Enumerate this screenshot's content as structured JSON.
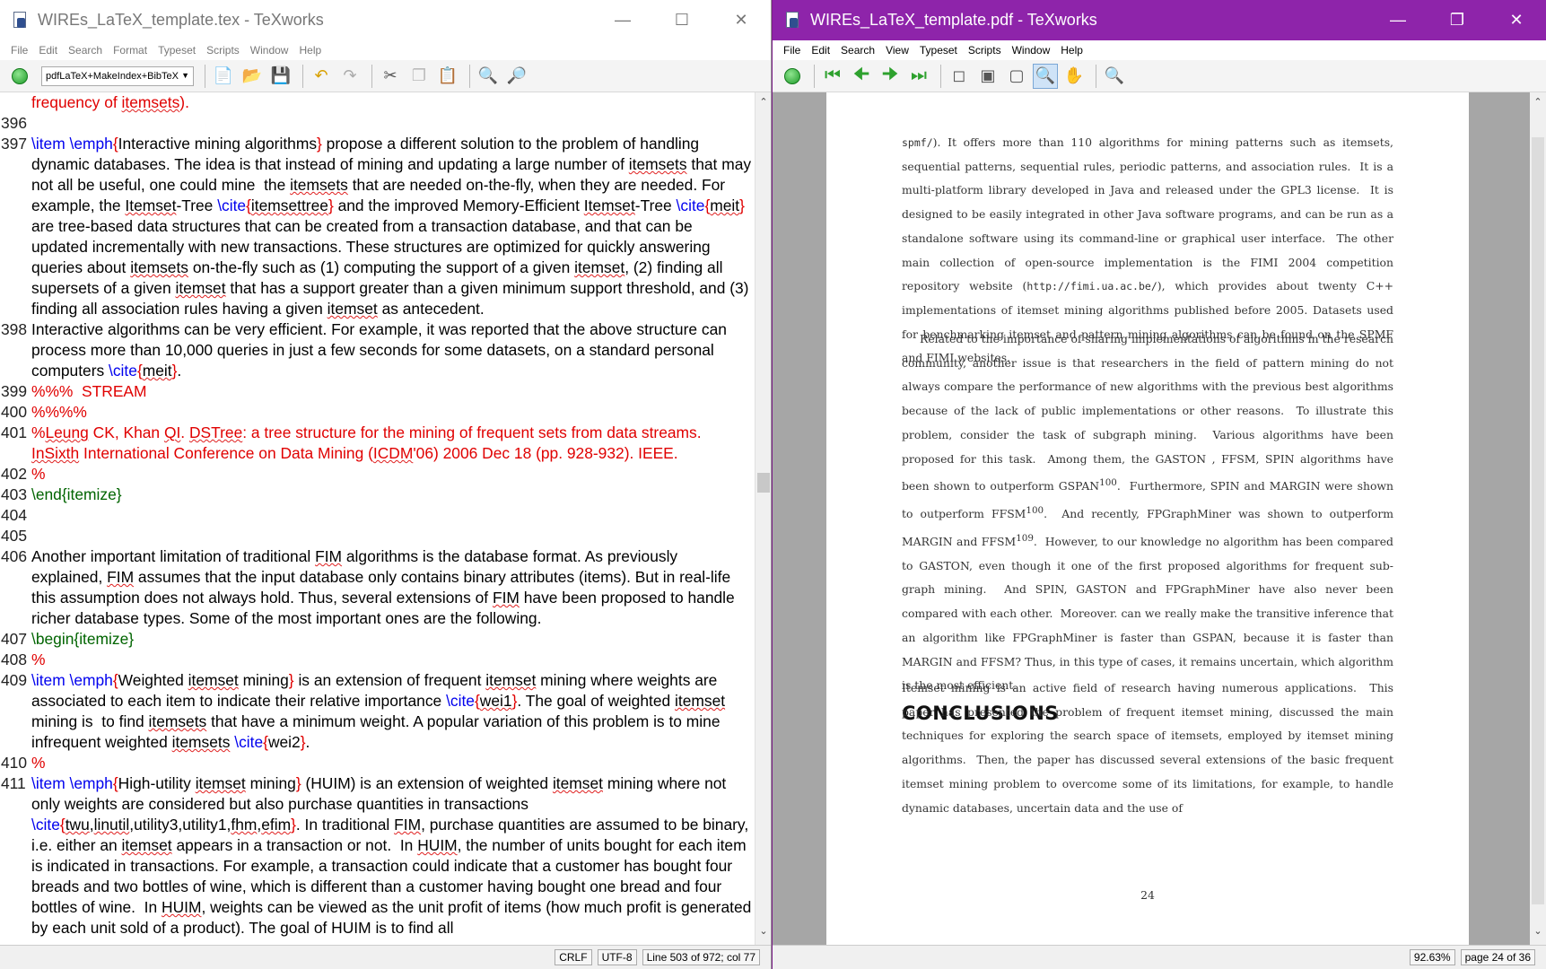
{
  "editor_window": {
    "title": "WIREs_LaTeX_template.tex - TeXworks",
    "menu": [
      "File",
      "Edit",
      "Search",
      "Format",
      "Typeset",
      "Scripts",
      "Window",
      "Help"
    ],
    "typeset_engine": "pdfLaTeX+MakeIndex+BibTeX",
    "status": {
      "line_ending": "CRLF",
      "encoding": "UTF-8",
      "position": "Line 503 of 972; col 77"
    },
    "lines": [
      {
        "n": "",
        "html": "<span class='red'>frequency of <span class='sq'>itemsets</span>).</span>"
      },
      {
        "n": "396",
        "html": ""
      },
      {
        "n": "397",
        "html": "<span class='blue'>\\item \\emph</span><span class='red'>{</span>Interactive mining algorithms<span class='red'>}</span> propose a different solution to the problem of handling dynamic databases. The idea is that instead of mining and updating a large number of <span class='sq'>itemsets</span> that may not all be useful, one could mine &nbsp;the <span class='sq'>itemsets</span> that are needed on-the-fly, when they are needed. For example, the <span class='sq'>Itemset</span>-Tree <span class='blue'>\\cite</span><span class='red'>{</span><span class='sq'>itemsettree</span><span class='red'>}</span> and the improved Memory-Efficient <span class='sq'>Itemset</span>-Tree <span class='blue'>\\cite</span><span class='red'>{</span><span class='sq'>meit</span><span class='red'>}</span> are tree-based data structures that can be created from a transaction database, and that can be updated incrementally with new transactions. These structures are optimized for quickly answering queries about <span class='sq'>itemsets</span> on-the-fly such as (1) computing the support of a given <span class='sq'>itemset</span>, (2) finding all supersets of a given <span class='sq'>itemset</span> that has a support greater than a given minimum support threshold, and (3) finding all association rules having a given <span class='sq'>itemset</span> as antecedent."
      },
      {
        "n": "398",
        "html": "Interactive algorithms can be very efficient. For example, it was reported that the above structure can process more than 10,000 queries in just a few seconds for some datasets, on a standard personal computers <span class='blue'>\\cite</span><span class='red'>{</span><span class='sq'>meit</span><span class='red'>}</span>."
      },
      {
        "n": "399",
        "html": "<span class='red'>%%% &nbsp;STREAM</span>"
      },
      {
        "n": "400",
        "html": "<span class='red'>%%%%</span>"
      },
      {
        "n": "401",
        "html": "<span class='red'>%<span class='sq'>Leung</span> CK, Khan <span class='sq'>QI</span>. <span class='sq'>DSTree</span>: a tree structure for the mining of frequent sets from data streams. <span class='sq'>InSixth</span> International Conference on Data Mining (<span class='sq'>ICDM</span>'06) 2006 Dec 18 (pp. 928-932). IEEE.</span>"
      },
      {
        "n": "402",
        "html": "<span class='red'>%</span>"
      },
      {
        "n": "403",
        "html": "<span class='green'>\\end{itemize}</span>"
      },
      {
        "n": "404",
        "html": ""
      },
      {
        "n": "405",
        "html": ""
      },
      {
        "n": "406",
        "html": "Another important limitation of traditional <span class='sq'>FIM</span> algorithms is the database format. As previously explained, <span class='sq'>FIM</span> assumes that the input database only contains binary attributes (items). But in real-life this assumption does not always hold. Thus, several extensions of <span class='sq'>FIM</span> have been proposed to handle richer database types. Some of the most important ones are the following."
      },
      {
        "n": "407",
        "html": "<span class='green'>\\begin{itemize}</span>"
      },
      {
        "n": "408",
        "html": "<span class='red'>%</span>"
      },
      {
        "n": "409",
        "html": "<span class='blue'>\\item \\emph</span><span class='red'>{</span>Weighted <span class='sq'>itemset</span> mining<span class='red'>}</span> is an extension of frequent <span class='sq'>itemset</span> mining where weights are associated to each item to indicate their relative importance <span class='blue'>\\cite</span><span class='red'>{</span><span class='sq'>wei1</span><span class='red'>}</span>. The goal of weighted <span class='sq'>itemset</span> mining is &nbsp;to find <span class='sq'>itemsets</span> that have a minimum weight. A popular variation of this problem is to mine infrequent weighted <span class='sq'>itemsets</span> <span class='blue'>\\cite</span><span class='red'>{</span>wei2<span class='red'>}</span>."
      },
      {
        "n": "410",
        "html": "<span class='red'>%</span>"
      },
      {
        "n": "411",
        "html": "<span class='blue'>\\item \\emph</span><span class='red'>{</span>High-utility <span class='sq'>itemset</span> mining<span class='red'>}</span> (HUIM) is an extension of weighted <span class='sq'>itemset</span> mining where not only weights are considered but also purchase quantities in transactions <span class='blue'>\\cite</span><span class='red'>{</span><span class='sq'>twu</span>,<span class='sq'>linutil</span>,utility3,utility1,<span class='sq'>fhm</span>,<span class='sq'>efim</span><span class='red'>}</span>. In traditional <span class='sq'>FIM</span>, purchase quantities are assumed to be binary, i.e. either an <span class='sq'>itemset</span> appears in a transaction or not. &nbsp;In <span class='sq'>HUIM</span>, the number of units bought for each item is indicated in transactions. For example, a transaction could indicate that a customer has bought four breads and two bottles of wine, which is different than a customer having bought one bread and four bottles of wine. &nbsp;In <span class='sq'>HUIM</span>, weights can be viewed as the unit profit of items (how much profit is generated by each unit sold of a product). The goal of HUIM is to find all"
      }
    ]
  },
  "viewer_window": {
    "title": "WIREs_LaTeX_template.pdf - TeXworks",
    "menu": [
      "File",
      "Edit",
      "Search",
      "View",
      "Typeset",
      "Scripts",
      "Window",
      "Help"
    ],
    "status": {
      "zoom": "92.63%",
      "page": "page 24 of 36"
    },
    "paragraph1": "<span class='mono'>spmf/</span>). It offers more than 110 algorithms for mining patterns such as itemsets, sequential patterns, sequential rules, periodic patterns, and association rules. &nbsp;It is a multi-platform library developed in Java and released under the GPL3 license. &nbsp;It is designed to be easily integrated in other Java software programs, and can be run as a standalone software using its command-line or graphical user interface. &nbsp;The other main collection of open-source implementation is the FIMI 2004 competition repository website (<span class='mono'>http://fimi.ua.ac.be/</span>), which provides about twenty C++ implementations of itemset mining algorithms published before 2005. Datasets used for benchmarking itemset and pattern mining algorithms can be found on the SPMF and FIMI websites.",
    "paragraph2": "Related to the importance of sharing implementations of algorithms in the research community, another issue is that researchers in the field of pattern mining do not always compare the performance of new algorithms with the previous best algorithms because of the lack of public implementations or other reasons. &nbsp;To illustrate this problem, consider the task of subgraph mining. &nbsp;Various algorithms have been proposed for this task. &nbsp;Among them, the GASTON , FFSM, SPIN algorithms have been shown to outperform GSPAN<sup>100</sup>. &nbsp;Furthermore, SPIN and MARGIN were shown to outperform FFSM<sup>100</sup>. &nbsp;And recently, FPGraphMiner was shown to outperform MARGIN and FFSM<sup>109</sup>. &nbsp;However, to our knowledge no algorithm has been compared to GASTON, even though it one of the first proposed algorithms for frequent sub-graph mining. &nbsp;And SPIN, GASTON and FPGraphMiner have also never been compared with each other. &nbsp;Moreover. can we really make the transitive inference that an algorithm like FPGraphMiner is faster than GSPAN, because it is faster than MARGIN and FFSM? Thus, in this type of cases, it remains uncertain, which algorithm is the most efficient.",
    "heading": "CONCLUSIONS",
    "paragraph3": "Itemset mining is an active field of research having numerous applications. &nbsp;This paper has presented the problem of frequent itemset mining, discussed the main techniques for exploring the search space of itemsets, employed by itemset mining algorithms. &nbsp;Then, the paper has discussed several extensions of the basic frequent itemset mining problem to overcome some of its limitations, for example, to handle dynamic databases, uncertain data and the use of",
    "page_number": "24"
  },
  "colors": {
    "viewer_titlebar": "#8e24aa",
    "command": "#0000ee",
    "comment": "#e00000",
    "environment": "#006400"
  },
  "icons": [
    "texworks-icon",
    "typeset-run-icon",
    "new-file-icon",
    "open-folder-icon",
    "save-icon",
    "undo-icon",
    "redo-icon",
    "cut-icon",
    "copy-icon",
    "paste-icon",
    "find-icon",
    "replace-icon",
    "first-page-icon",
    "prev-page-icon",
    "next-page-icon",
    "last-page-icon",
    "actual-size-icon",
    "fit-width-icon",
    "fit-window-icon",
    "magnifier-icon",
    "hand-icon"
  ]
}
